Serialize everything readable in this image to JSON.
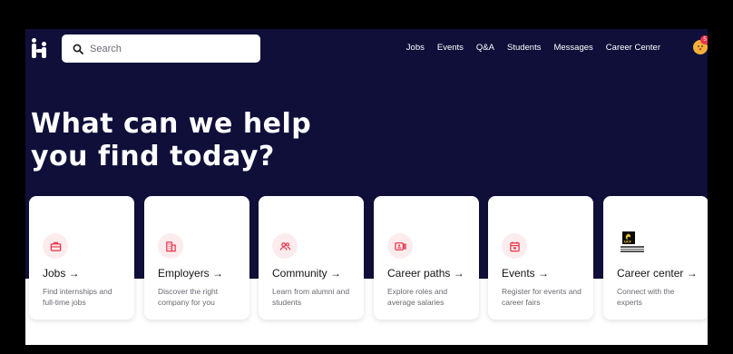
{
  "header": {
    "search_placeholder": "Search",
    "nav": [
      "Jobs",
      "Events",
      "Q&A",
      "Students",
      "Messages",
      "Career Center"
    ],
    "notification_count": "5"
  },
  "hero": {
    "headline_line1": "What can we help",
    "headline_line2": "you find today?"
  },
  "cards": [
    {
      "title": "Jobs →",
      "desc": "Find internships and full-time jobs",
      "icon": "briefcase-icon"
    },
    {
      "title": "Employers →",
      "desc": "Discover the right company for you",
      "icon": "building-icon"
    },
    {
      "title": "Community →",
      "desc": "Learn from alumni and students",
      "icon": "people-icon"
    },
    {
      "title": "Career paths →",
      "desc": "Explore roles and average salaries",
      "icon": "id-card-icon"
    },
    {
      "title": "Events →",
      "desc": "Register for events and career fairs",
      "icon": "calendar-icon"
    },
    {
      "title": "Career center →",
      "desc": "Connect with the experts",
      "icon": "ucf-logo"
    }
  ],
  "colors": {
    "hero_bg": "#0f0f3a",
    "accent": "#e8324a",
    "icon_bg": "#fdeced"
  }
}
